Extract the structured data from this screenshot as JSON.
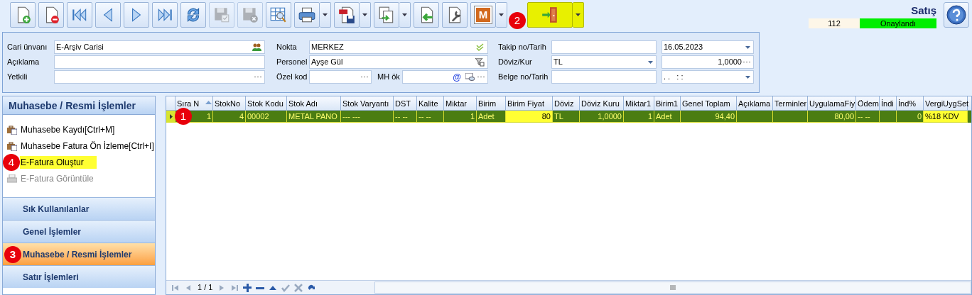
{
  "toolbar": [
    {
      "kind": "new",
      "disabled": false,
      "dropdown": false,
      "highlighted": false
    },
    {
      "kind": "delete",
      "disabled": false,
      "dropdown": false,
      "highlighted": false
    },
    {
      "kind": "first",
      "disabled": false,
      "dropdown": false,
      "highlighted": false
    },
    {
      "kind": "previous",
      "disabled": false,
      "dropdown": false,
      "highlighted": false
    },
    {
      "kind": "next",
      "disabled": false,
      "dropdown": false,
      "highlighted": false
    },
    {
      "kind": "last",
      "disabled": false,
      "dropdown": false,
      "highlighted": false
    },
    {
      "kind": "refresh",
      "disabled": false,
      "dropdown": false,
      "highlighted": false
    },
    {
      "kind": "save",
      "disabled": true,
      "dropdown": false,
      "highlighted": false
    },
    {
      "kind": "discard",
      "disabled": true,
      "dropdown": false,
      "highlighted": false
    },
    {
      "kind": "preview",
      "disabled": false,
      "dropdown": false,
      "highlighted": false
    },
    {
      "kind": "print",
      "disabled": false,
      "dropdown": true,
      "highlighted": false
    },
    {
      "kind": "pdf",
      "disabled": false,
      "dropdown": true,
      "highlighted": false
    },
    {
      "kind": "export",
      "disabled": false,
      "dropdown": true,
      "highlighted": false
    },
    {
      "kind": "import",
      "disabled": false,
      "dropdown": false,
      "highlighted": false
    },
    {
      "kind": "settings",
      "disabled": false,
      "dropdown": false,
      "highlighted": false
    },
    {
      "kind": "letter",
      "label": "M",
      "disabled": false,
      "dropdown": true,
      "highlighted": false
    },
    {
      "kind": "exit",
      "disabled": false,
      "dropdown": true,
      "highlighted": true,
      "marker": "2"
    }
  ],
  "document": {
    "title": "Satış",
    "number": "112",
    "status": "Onaylandı"
  },
  "form": {
    "left": [
      {
        "label": "Cari ünvanı",
        "value": "E-Arşiv Carisi"
      },
      {
        "label": "Açıklama"
      },
      {
        "label": "Yetkili"
      }
    ],
    "middle": [
      {
        "label": "Nokta",
        "value": "MERKEZ"
      },
      {
        "label": "Personel",
        "value": "Ayşe Gül"
      },
      {
        "label": "Özel kod",
        "extra": {
          "label": "MH ök",
          "button": "@"
        }
      }
    ],
    "right": [
      {
        "label": "Takip no/Tarih",
        "value_2": "16.05.2023"
      },
      {
        "label": "Döviz/Kur",
        "value": "TL",
        "value_2": "1,0000"
      },
      {
        "label": "Belge no/Tarih",
        "value_2": ". .   : :"
      }
    ]
  },
  "sidebar": {
    "title": "Muhasebe / Resmi İşlemler",
    "items": [
      {
        "label": "Muhasebe Kaydı[Ctrl+M]",
        "disabled": false,
        "highlighted": false
      },
      {
        "label": "Muhasebe Fatura Ön İzleme[Ctrl+I]",
        "disabled": false,
        "highlighted": false
      },
      {
        "label": "E-Fatura Oluştur",
        "disabled": false,
        "highlighted": true,
        "marker": "4"
      },
      {
        "label": "E-Fatura Görüntüle",
        "disabled": true,
        "highlighted": false
      }
    ],
    "groups": [
      {
        "label": "Sık Kullanılanlar",
        "selected": false
      },
      {
        "label": "Genel İşlemler",
        "selected": false
      },
      {
        "label": "Muhasebe / Resmi İşlemler",
        "selected": true,
        "marker": "3"
      },
      {
        "label": "Satır İşlemleri",
        "selected": false
      }
    ]
  },
  "table": {
    "columns": [
      {
        "label": "Sıra N",
        "sorted": true
      },
      {
        "label": "StokNo",
        "sorted": false
      },
      {
        "label": "Stok Kodu",
        "sorted": false
      },
      {
        "label": "Stok Adı",
        "sorted": false
      },
      {
        "label": "Stok Varyantı",
        "sorted": false
      },
      {
        "label": "DST",
        "sorted": false
      },
      {
        "label": "Kalite",
        "sorted": false
      },
      {
        "label": "Miktar",
        "sorted": false
      },
      {
        "label": "Birim",
        "sorted": false
      },
      {
        "label": "Birim Fiyat",
        "sorted": false
      },
      {
        "label": "Döviz",
        "sorted": false
      },
      {
        "label": "Döviz Kuru",
        "sorted": false
      },
      {
        "label": "Miktar1",
        "sorted": false
      },
      {
        "label": "Birim1",
        "sorted": false
      },
      {
        "label": "Genel Toplam",
        "sorted": false
      },
      {
        "label": "Açıklama",
        "sorted": false
      },
      {
        "label": "Terminler",
        "sorted": false
      },
      {
        "label": "UygulamaFiy",
        "sorted": false
      },
      {
        "label": "Ödem",
        "sorted": false
      },
      {
        "label": "İndi",
        "sorted": false
      },
      {
        "label": "İnd%",
        "sorted": false
      },
      {
        "label": "VergiUygSet",
        "sorted": false
      }
    ],
    "rows": [
      {
        "selected": true,
        "marker": "1",
        "cells": [
          "1",
          "4",
          "00002",
          "METAL PANO",
          "--- ---",
          "-- --",
          "-- --",
          "1",
          "Adet",
          "80",
          "TL",
          "1,0000",
          "1",
          "Adet",
          "94,40",
          null,
          null,
          "80,00",
          "-- --",
          null,
          "0",
          "%18 KDV"
        ]
      }
    ],
    "pager": "1 / 1"
  }
}
